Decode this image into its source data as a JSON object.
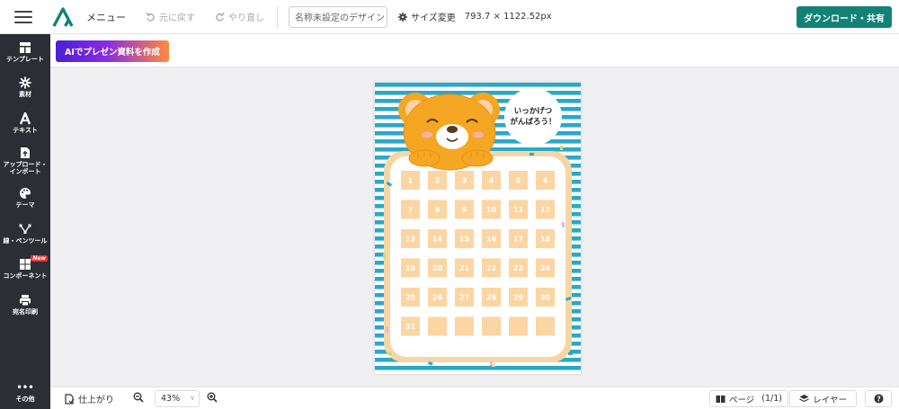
{
  "topbar": {
    "menu_label": "メニュー",
    "undo_label": "元に戻す",
    "redo_label": "やり直し",
    "doc_name_placeholder": "名称未設定のデザイン",
    "size_change_label": "サイズ変更",
    "size_value": "793.7 × 1122.52px",
    "download_label": "ダウンロード・共有"
  },
  "sidebar": {
    "items": [
      {
        "label": "テンプレート",
        "icon": "template-icon"
      },
      {
        "label": "素材",
        "icon": "material-icon"
      },
      {
        "label": "テキスト",
        "icon": "text-icon"
      },
      {
        "label_line1": "アップロード・",
        "label_line2": "インポート",
        "icon": "upload-icon"
      },
      {
        "label": "テーマ",
        "icon": "palette-icon"
      },
      {
        "label": "線・ペンツール",
        "icon": "pen-tool-icon"
      },
      {
        "label": "コンポーネント",
        "icon": "component-icon",
        "badge": "New"
      },
      {
        "label": "宛名印刷",
        "icon": "print-icon"
      }
    ],
    "more_label": "その他"
  },
  "subbar": {
    "ai_button_label": "AIでプレゼン資料を作成"
  },
  "design": {
    "speech_line1": "いっかげつ",
    "speech_line2": "がんばろう！",
    "calendar_days": [
      "1",
      "2",
      "3",
      "4",
      "5",
      "6",
      "7",
      "8",
      "9",
      "10",
      "11",
      "12",
      "13",
      "14",
      "15",
      "16",
      "17",
      "18",
      "19",
      "20",
      "21",
      "22",
      "23",
      "24",
      "25",
      "26",
      "27",
      "28",
      "29",
      "30",
      "31",
      "",
      "",
      "",
      "",
      ""
    ],
    "colors": {
      "stripe": "#29a9c7",
      "frame": "#f8d6a4",
      "cell": "#fbd5a2",
      "bear": "#f5a623"
    }
  },
  "bottombar": {
    "finish_label": "仕上がり",
    "zoom_value": "43%",
    "pages_label": "ページ",
    "pages_count": "(1/1)",
    "layer_label": "レイヤー"
  }
}
